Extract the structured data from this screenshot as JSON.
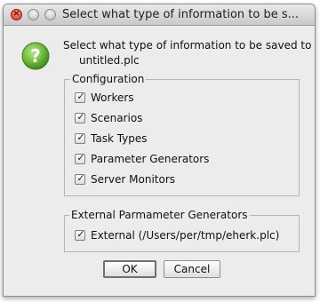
{
  "window": {
    "title": "Select what type of information to be s..."
  },
  "titlebar": {
    "close_glyph": "×"
  },
  "icons": {
    "help": "question-mark-icon"
  },
  "message": {
    "line1": "Select what type of information to be saved to",
    "line2": "untitled.plc"
  },
  "configuration": {
    "label": "Configuration",
    "items": [
      {
        "label": "Workers",
        "checked": true
      },
      {
        "label": "Scenarios",
        "checked": true
      },
      {
        "label": "Task Types",
        "checked": true
      },
      {
        "label": "Parameter Generators",
        "checked": true
      },
      {
        "label": "Server Monitors",
        "checked": true
      }
    ]
  },
  "external": {
    "label": "External Parmameter Generators",
    "items": [
      {
        "label": "External (/Users/per/tmp/eherk.plc)",
        "checked": true
      }
    ]
  },
  "buttons": {
    "ok": "OK",
    "cancel": "Cancel"
  },
  "checkmark_glyph": "✓",
  "colors": {
    "help_icon": "#5fb030",
    "window_bg": "#ececec"
  }
}
